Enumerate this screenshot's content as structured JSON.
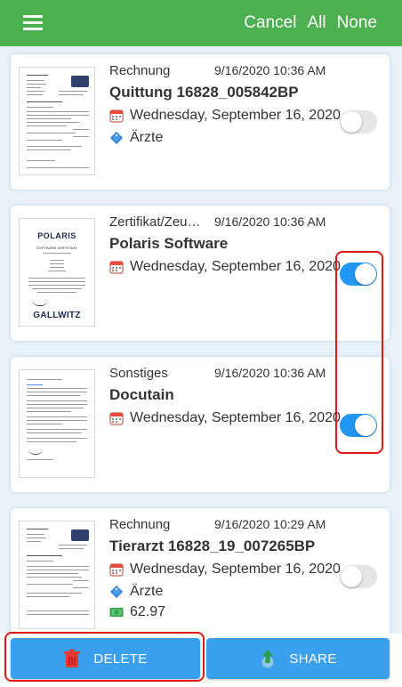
{
  "header": {
    "cancel": "Cancel",
    "all": "All",
    "none": "None"
  },
  "documents": [
    {
      "type": "Rechnung",
      "timestamp": "9/16/2020 10:36 AM",
      "title": "Quittung 16828_005842BP",
      "date": "Wednesday, September 16, 2020",
      "tag": "Ärzte",
      "selected": false
    },
    {
      "type": "Zertifikat/Zeugnis",
      "timestamp": "9/16/2020 10:36 AM",
      "title": "Polaris  Software",
      "date": "Wednesday, September 16, 2020",
      "selected": true,
      "thumb_brand_top": "POLARIS",
      "thumb_heading": "SOFTWARE ZERTIFIKAT",
      "thumb_brand_bottom": "GALLWITZ"
    },
    {
      "type": "Sonstiges",
      "timestamp": "9/16/2020 10:36 AM",
      "title": "Docutain",
      "date": "Wednesday, September 16, 2020",
      "selected": true
    },
    {
      "type": "Rechnung",
      "timestamp": "9/16/2020 10:29 AM",
      "title": "Tierarzt 16828_19_007265BP",
      "date": "Wednesday, September 16, 2020",
      "tag": "Ärzte",
      "amount": "62.97",
      "selected": false
    }
  ],
  "actions": {
    "delete": "DELETE",
    "share": "SHARE"
  },
  "colors": {
    "header": "#4caf50",
    "accent": "#2196f3",
    "button": "#3aa0ee",
    "highlight": "#e01818"
  }
}
